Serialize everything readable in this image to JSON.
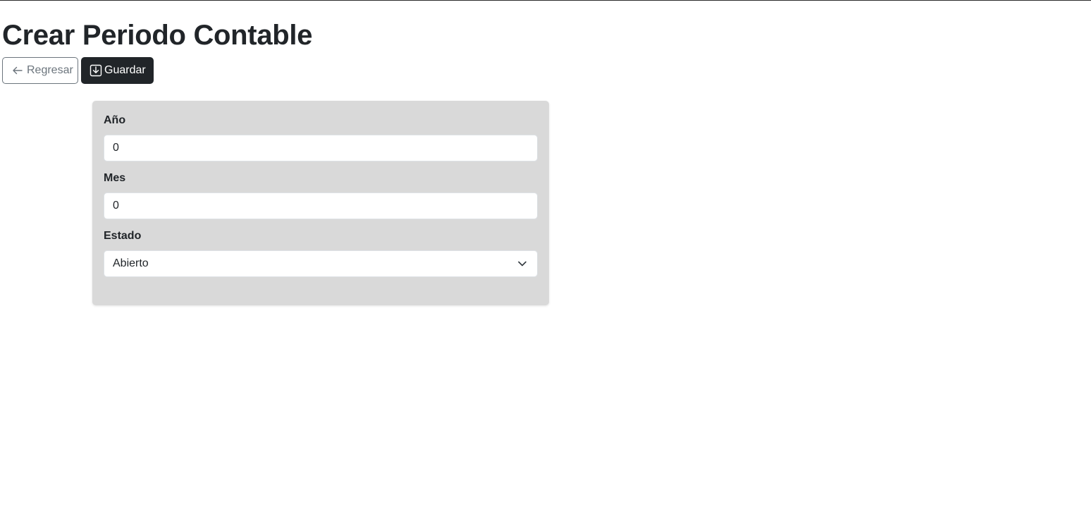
{
  "page": {
    "title": "Crear Periodo Contable"
  },
  "toolbar": {
    "back_label": "Regresar",
    "save_label": "Guardar"
  },
  "form": {
    "year": {
      "label": "Año",
      "value": "0"
    },
    "month": {
      "label": "Mes",
      "value": "0"
    },
    "status": {
      "label": "Estado",
      "selected": "Abierto"
    }
  },
  "icons": {
    "back": "arrow-left-icon",
    "save": "download-icon",
    "select": "chevron-down-icon"
  },
  "colors": {
    "primary_dark": "#212529",
    "secondary": "#6c757d",
    "card_bg": "#d9d9d9"
  }
}
